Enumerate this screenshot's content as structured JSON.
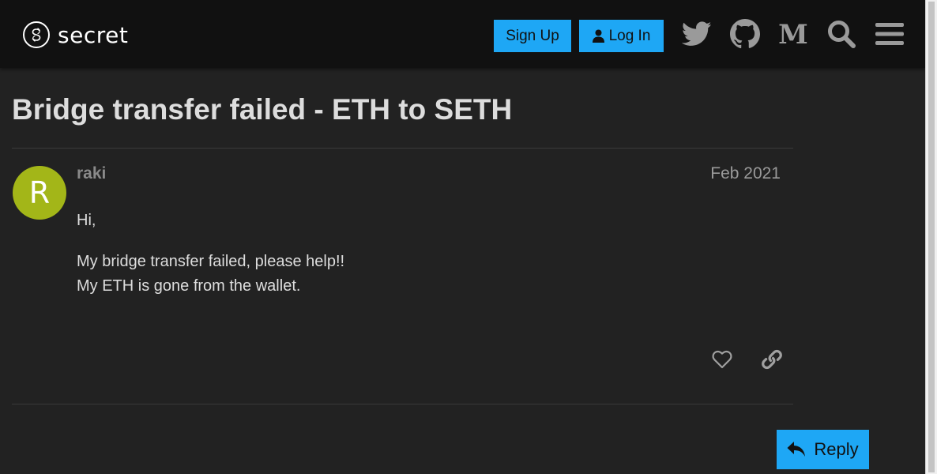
{
  "header": {
    "logo_text": "secret",
    "signup_label": "Sign Up",
    "login_label": "Log In",
    "icons": [
      "twitter-icon",
      "github-icon",
      "medium-icon",
      "search-icon",
      "hamburger-menu-icon"
    ]
  },
  "topic": {
    "title": "Bridge transfer failed - ETH to SETH"
  },
  "post": {
    "avatar_letter": "R",
    "username": "raki",
    "date": "Feb 2021",
    "paragraphs": [
      "Hi,",
      "My bridge transfer failed, please help!!",
      "My ETH is gone from the wallet."
    ],
    "actions": [
      "heart-icon",
      "link-icon"
    ]
  },
  "footer": {
    "reply_label": "Reply"
  },
  "colors": {
    "background": "#222222",
    "header": "#111111",
    "accent": "#1ea7f5",
    "avatar": "#a3b618",
    "text": "#dddddd"
  }
}
